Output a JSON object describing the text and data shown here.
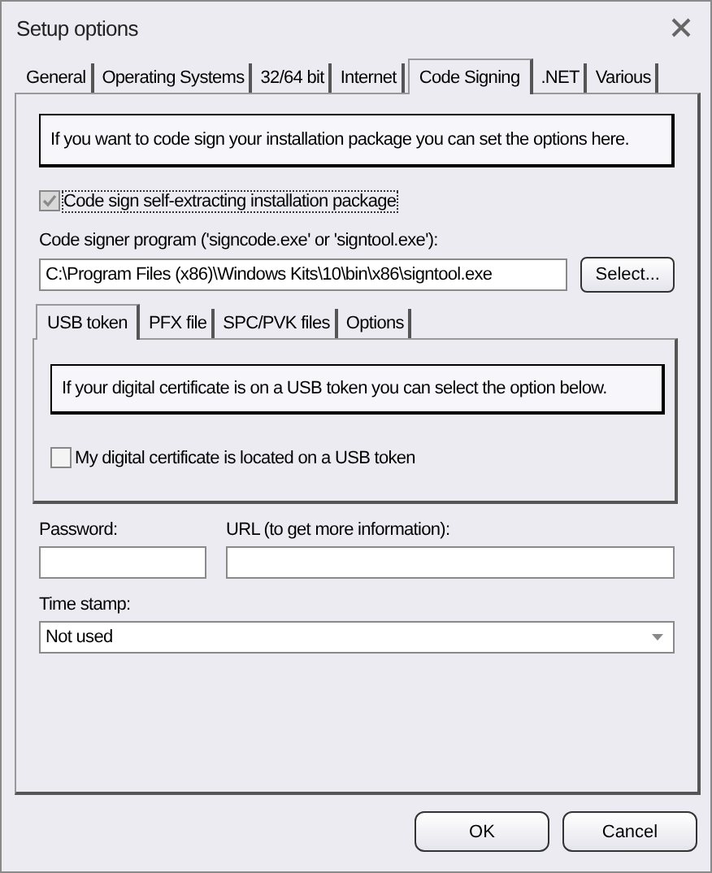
{
  "window": {
    "title": "Setup options"
  },
  "tabs": [
    {
      "label": "General",
      "selected": false
    },
    {
      "label": "Operating Systems",
      "selected": false
    },
    {
      "label": "32/64 bit",
      "selected": false
    },
    {
      "label": "Internet",
      "selected": false
    },
    {
      "label": "Code Signing",
      "selected": true
    },
    {
      "label": ".NET",
      "selected": false
    },
    {
      "label": "Various",
      "selected": false
    }
  ],
  "intro": "If you want to code sign your installation package you can set the options here.",
  "sign_checkbox": {
    "label": "Code sign self-extracting installation package",
    "checked": true,
    "disabled": true
  },
  "signer": {
    "label": "Code signer program ('signcode.exe' or 'signtool.exe'):",
    "value": "C:\\Program Files (x86)\\Windows Kits\\10\\bin\\x86\\signtool.exe",
    "button": "Select..."
  },
  "sub_tabs": [
    {
      "label": "USB token",
      "selected": true
    },
    {
      "label": "PFX file",
      "selected": false
    },
    {
      "label": "SPC/PVK files",
      "selected": false
    },
    {
      "label": "Options",
      "selected": false
    }
  ],
  "usb": {
    "info": "If your digital certificate is on a USB token you can select the option below.",
    "checkbox": {
      "label": "My digital certificate is located on a USB token",
      "checked": false
    }
  },
  "password": {
    "label": "Password:"
  },
  "url": {
    "label": "URL (to get more information):"
  },
  "timestamp": {
    "label": "Time stamp:",
    "value": "Not used"
  },
  "buttons": [
    "OK",
    "Cancel"
  ]
}
